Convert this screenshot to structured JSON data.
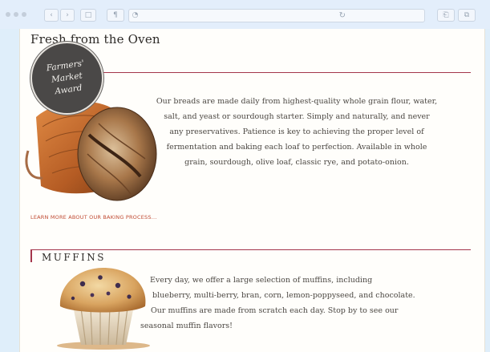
{
  "browser": {
    "reload_glyph": "↻",
    "back_glyph": "‹",
    "forward_glyph": "›",
    "sidebar_glyph": "□",
    "reader_glyph": "¶",
    "history_glyph": "◔",
    "share_glyph": "⎗",
    "tabs_glyph": "⧉"
  },
  "page": {
    "title": "Fresh from the Oven",
    "award_badge": [
      "Farmers'",
      "Market",
      "Award"
    ],
    "bread": {
      "paragraph_lines": [
        "Our breads are made daily from highest-quality whole grain flour, water,",
        "salt, and yeast or sourdough starter. Simply and naturally, and never",
        "any preservatives. Patience is key to achieving the proper level of",
        "fermentation and baking each loaf to perfection. Available in whole",
        "grain, sourdough, olive loaf, classic rye, and potato-onion."
      ],
      "learn_more": "LEARN MORE ABOUT OUR BAKING PROCESS..."
    },
    "muffins": {
      "heading": "MUFFINS",
      "paragraph_lines": [
        "Every day, we offer a large selection of muffins, including",
        "blueberry, multi-berry, bran, corn, lemon-poppyseed, and chocolate.",
        "Our muffins are made from scratch each day. Stop by to see our",
        "seasonal muffin flavors!"
      ]
    }
  }
}
